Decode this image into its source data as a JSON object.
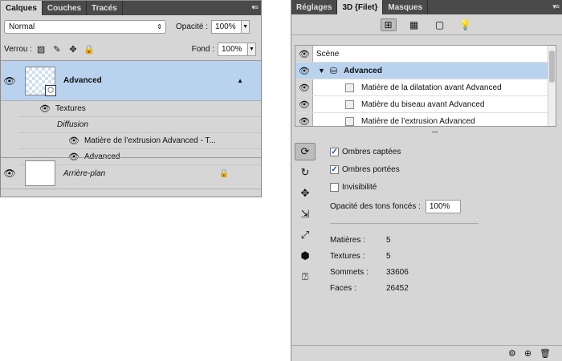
{
  "left_panel": {
    "tabs": [
      "Calques",
      "Couches",
      "Tracés"
    ],
    "blend_mode": "Normal",
    "opacity_label": "Opacité :",
    "opacity_value": "100%",
    "lock_label": "Verrou :",
    "fill_label": "Fond :",
    "fill_value": "100%",
    "layers": {
      "advanced": "Advanced",
      "textures": "Textures",
      "diffusion": "Diffusion",
      "extrusion_material": "Matière de l’extrusion Advanced - T...",
      "advanced_sub": "Advanced",
      "background": "Arrière-plan"
    }
  },
  "right_panel": {
    "tabs": [
      "Réglages",
      "3D {Filet}",
      "Masques"
    ],
    "scene_label": "Scène",
    "scene_items": {
      "advanced": "Advanced",
      "item1": "Matière de la dilatation avant Advanced",
      "item2": "Matière du biseau avant Advanced",
      "item3": "Matière de l’extrusion Advanced"
    },
    "options": {
      "captured_shadows": "Ombres captées",
      "cast_shadows": "Ombres portées",
      "invisibility": "Invisibilité",
      "shadow_opacity_label": "Opacité des tons foncés :",
      "shadow_opacity_value": "100%"
    },
    "stats": {
      "materials_label": "Matières :",
      "materials_value": "5",
      "textures_label": "Textures :",
      "textures_value": "5",
      "vertices_label": "Sommets :",
      "vertices_value": "33606",
      "faces_label": "Faces :",
      "faces_value": "26452"
    }
  }
}
